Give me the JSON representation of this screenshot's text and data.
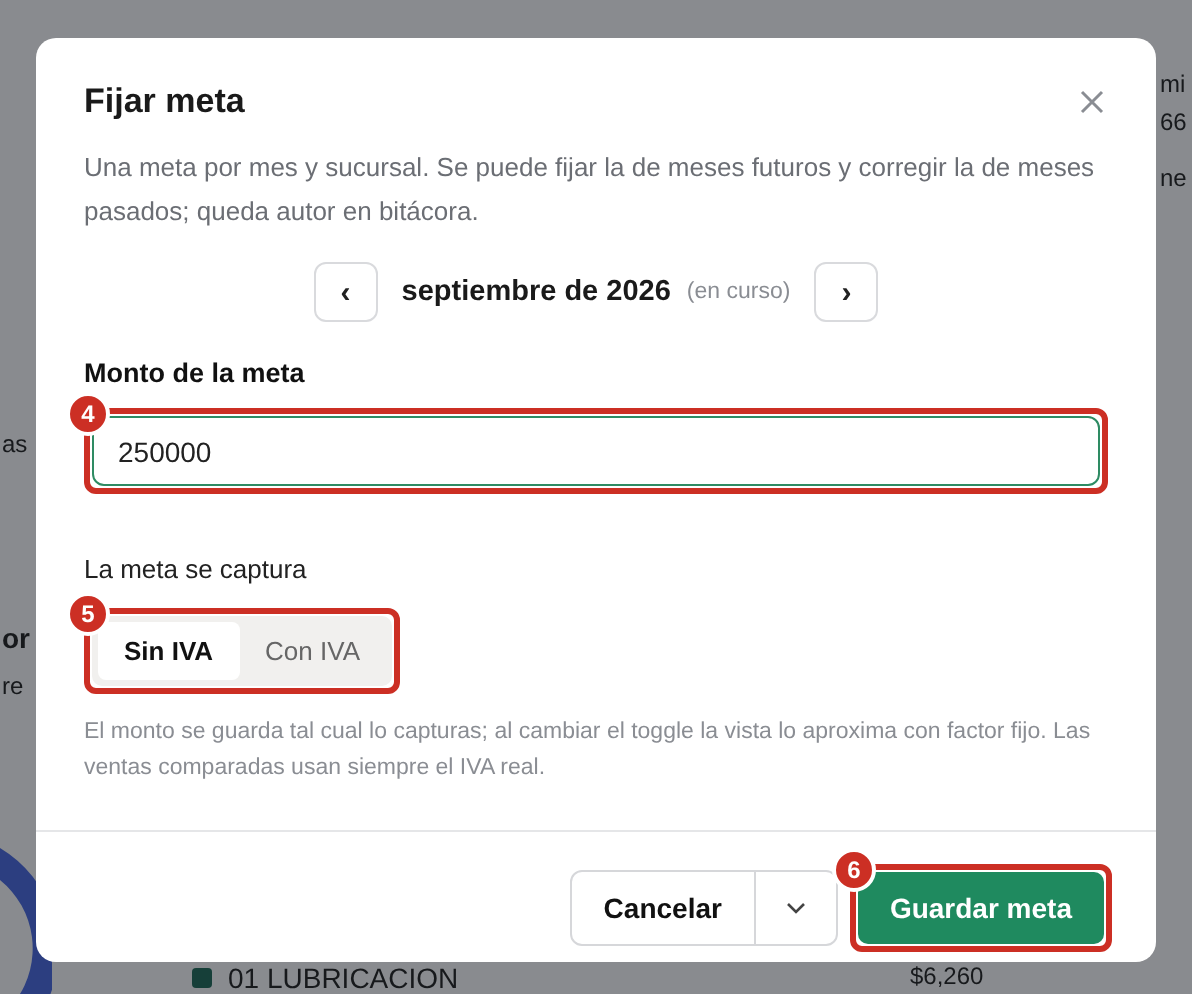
{
  "background": {
    "texts": [
      {
        "text": "mi",
        "kind": "plain"
      },
      {
        "text": "66",
        "kind": "plain"
      },
      {
        "text": "ne",
        "kind": "plain"
      },
      {
        "text": "as",
        "kind": "plain"
      },
      {
        "text": "or",
        "kind": "heading"
      },
      {
        "text": "re",
        "kind": "plain"
      },
      {
        "text": "01 LUBRICACION",
        "kind": "legend"
      },
      {
        "text": "$6,260",
        "kind": "plain"
      }
    ]
  },
  "dialog": {
    "title": "Fijar meta",
    "description": "Una meta por mes y sucursal. Se puede fijar la de meses futuros y corregir la de meses pasados; queda autor en bitácora.",
    "month": {
      "prev": "‹",
      "label": "septiembre de 2026",
      "note": "(en curso)",
      "next": "›"
    },
    "amount": {
      "label": "Monto de la meta",
      "value": "250000",
      "marker": "4"
    },
    "capture": {
      "label": "La meta se captura",
      "marker": "5",
      "options": [
        {
          "label": "Sin IVA",
          "selected": true
        },
        {
          "label": "Con IVA",
          "selected": false
        }
      ]
    },
    "help": "El monto se guarda tal cual lo capturas; al cambiar el toggle la vista lo aproxima con factor fijo. Las ventas comparadas usan siempre el IVA real.",
    "buttons": {
      "cancel": "Cancelar",
      "save": "Guardar meta",
      "save_marker": "6"
    }
  }
}
